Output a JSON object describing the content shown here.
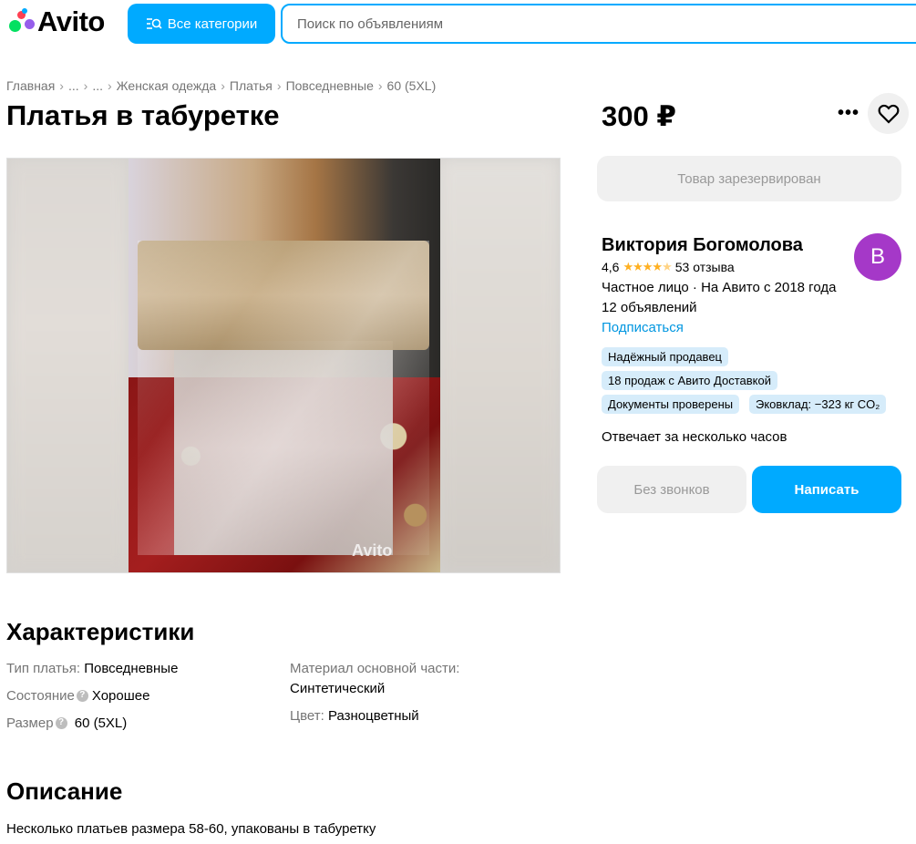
{
  "header": {
    "logo_text": "Avito",
    "categories_label": "Все категории",
    "search_placeholder": "Поиск по объявлениям"
  },
  "breadcrumb": [
    "Главная",
    "...",
    "...",
    "Женская одежда",
    "Платья",
    "Повседневные",
    "60 (5XL)"
  ],
  "listing": {
    "title": "Платья в табуретке",
    "price": "300 ₽",
    "reserved_label": "Товар зарезервирован",
    "watermark": "Avito"
  },
  "seller": {
    "name": "Виктория Богомолова",
    "avatar_letter": "В",
    "avatar_color": "#a538c8",
    "rating": "4,6",
    "rating_stars": 4.5,
    "reviews": "53 отзыва",
    "info": "Частное лицо · На Авито с 2018 года",
    "ads_count": "12 объявлений",
    "subscribe_label": "Подписаться",
    "tags": [
      "Надёжный продавец",
      "18 продаж с Авито Доставкой",
      "Документы проверены",
      "Эковклад: −323 кг CO₂"
    ],
    "responds": "Отвечает за несколько часов",
    "no_calls_label": "Без звонков",
    "write_label": "Написать"
  },
  "specs": {
    "heading": "Характеристики",
    "type_label": "Тип платья:",
    "type_value": "Повседневные",
    "condition_label": "Состояние",
    "condition_value": "Хорошее",
    "size_label": "Размер",
    "size_value": "60 (5XL)",
    "material_label": "Материал основной части:",
    "material_value": "Синтетический",
    "color_label": "Цвет:",
    "color_value": "Разноцветный"
  },
  "description": {
    "heading": "Описание",
    "text": "Несколько платьев размера 58-60, упакованы в табуретку"
  },
  "colors": {
    "accent": "#00aaff",
    "link": "#0096e0",
    "tag_bg": "#d6ecfa"
  }
}
